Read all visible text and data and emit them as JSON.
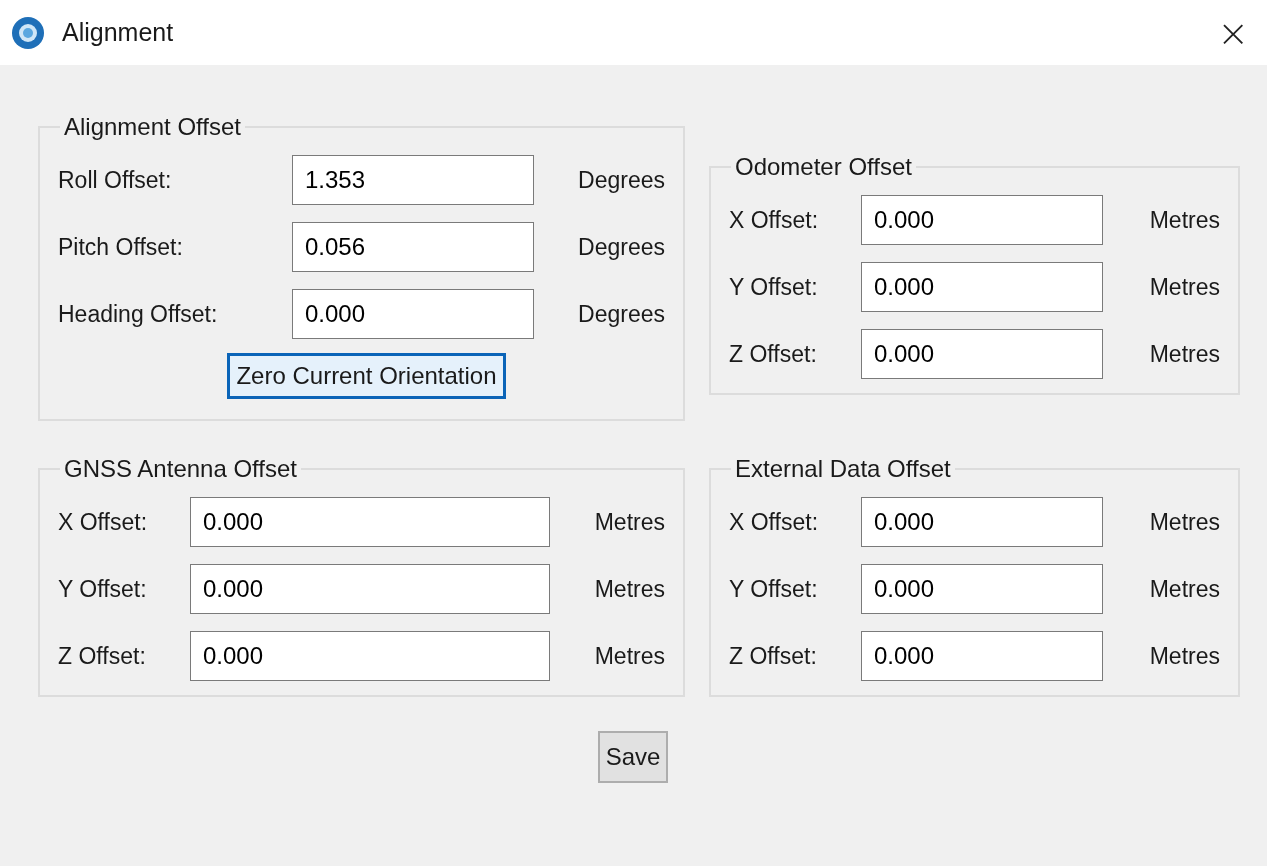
{
  "window": {
    "title": "Alignment",
    "close": "×"
  },
  "groups": [
    {
      "title": "Alignment Offset",
      "rows": [
        {
          "label": "Roll Offset:",
          "value": "1.353",
          "unit": "Degrees"
        },
        {
          "label": "Pitch Offset:",
          "value": "0.056",
          "unit": "Degrees"
        },
        {
          "label": "Heading Offset:",
          "value": "0.000",
          "unit": "Degrees"
        }
      ],
      "button": {
        "label": "Zero Current Orientation",
        "focused": true
      }
    },
    {
      "title": "Odometer Offset",
      "rows": [
        {
          "label": "X Offset:",
          "value": "0.000",
          "unit": "Metres"
        },
        {
          "label": "Y Offset:",
          "value": "0.000",
          "unit": "Metres"
        },
        {
          "label": "Z Offset:",
          "value": "0.000",
          "unit": "Metres"
        }
      ]
    },
    {
      "title": "GNSS Antenna Offset",
      "rows": [
        {
          "label": "X Offset:",
          "value": "0.000",
          "unit": "Metres"
        },
        {
          "label": "Y Offset:",
          "value": "0.000",
          "unit": "Metres"
        },
        {
          "label": "Z Offset:",
          "value": "0.000",
          "unit": "Metres"
        }
      ]
    },
    {
      "title": "External Data Offset",
      "rows": [
        {
          "label": "X Offset:",
          "value": "0.000",
          "unit": "Metres"
        },
        {
          "label": "Y Offset:",
          "value": "0.000",
          "unit": "Metres"
        },
        {
          "label": "Z Offset:",
          "value": "0.000",
          "unit": "Metres"
        }
      ]
    }
  ],
  "save": {
    "label": "Save",
    "focused": false
  }
}
